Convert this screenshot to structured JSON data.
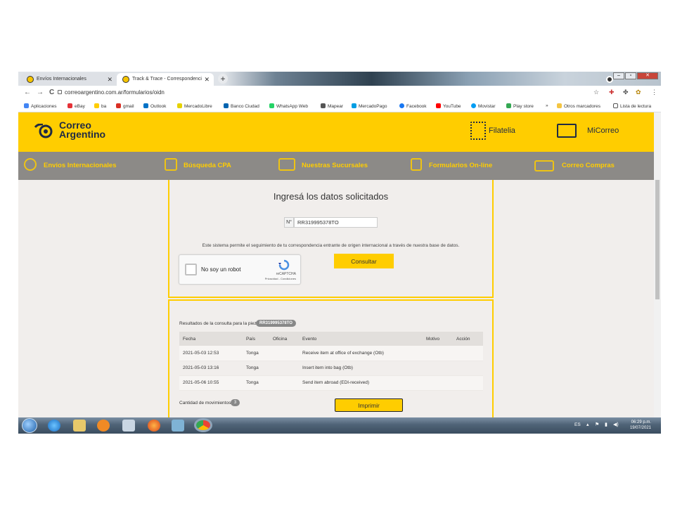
{
  "browser": {
    "tabs": [
      {
        "label": "Envíos Internacionales"
      },
      {
        "label": "Track & Trace - Correspondenci"
      }
    ],
    "new_tab": "+",
    "url": "correoargentino.com.ar/formularios/oidn",
    "nav": {
      "back": "←",
      "forward": "→",
      "reload": "C"
    },
    "bookmarks": [
      {
        "label": "Aplicaciones",
        "color": "#4285f4"
      },
      {
        "label": "eBay",
        "color": "#e53238"
      },
      {
        "label": "ba",
        "color": "#ffcd00"
      },
      {
        "label": "gmail",
        "color": "#d93025"
      },
      {
        "label": "Outlook",
        "color": "#0072c6"
      },
      {
        "label": "MercadoLibre",
        "color": "#fff159"
      },
      {
        "label": "Banco Ciudad",
        "color": "#0064b0"
      },
      {
        "label": "WhatsApp Web",
        "color": "#25d366"
      },
      {
        "label": "Mapear",
        "color": "#555555"
      },
      {
        "label": "MercadoPago",
        "color": "#009ee3"
      },
      {
        "label": "Facebook",
        "color": "#1877f2"
      },
      {
        "label": "YouTube",
        "color": "#ff0000"
      },
      {
        "label": "Movistar",
        "color": "#019df4"
      },
      {
        "label": "Play store",
        "color": "#34a853"
      }
    ],
    "bookmarks_more": "»",
    "other_bookmarks": "Otros marcadores",
    "reading_list": "Lista de lectura"
  },
  "site": {
    "logo": {
      "line1": "Correo",
      "line2": "Argentino"
    },
    "header_links": [
      {
        "label": "Filatelia"
      },
      {
        "label": "MiCorreo"
      }
    ],
    "nav": [
      {
        "label": "Envíos Internacionales"
      },
      {
        "label": "Búsqueda CPA"
      },
      {
        "label": "Nuestras Sucursales"
      },
      {
        "label": "Formularios On-line"
      },
      {
        "label": "Correo Compras"
      }
    ],
    "form": {
      "title": "Ingresá los datos solicitados",
      "number_label": "N°",
      "tracking_value": "RR319995378TO",
      "description": "Este sistema permite el seguimiento de tu correspondencia entrante de origen internacional a través de nuestra base de datos.",
      "captcha_label": "No soy un robot",
      "captcha_brand": "reCAPTCHA",
      "captcha_terms": "Privacidad - Condiciones",
      "submit_label": "Consultar"
    },
    "results": {
      "label": "Resultados de la consulta para la pieza:",
      "piece_id": "RR319995378TO",
      "columns": [
        "Fecha",
        "País",
        "Oficina",
        "Evento",
        "Motivo",
        "Acción"
      ],
      "rows": [
        [
          "2021-05-03 12:53",
          "Tonga",
          "",
          "Receive item at office of exchange (Otb)",
          "",
          ""
        ],
        [
          "2021-05-03 13:16",
          "Tonga",
          "",
          "Insert item into bag (Otb)",
          "",
          ""
        ],
        [
          "2021-05-06 10:55",
          "Tonga",
          "",
          "Send item abroad (EDI-received)",
          "",
          ""
        ]
      ],
      "count_label": "Cantidad de movimientos",
      "count": "3",
      "print_label": "Imprimir"
    }
  },
  "taskbar": {
    "language": "ES",
    "time": "06:29 p.m.",
    "date": "19/07/2021"
  },
  "colors": {
    "brand_yellow": "#ffcd00",
    "brand_navy": "#1f2a44",
    "nav_gray": "#8c8a87"
  }
}
